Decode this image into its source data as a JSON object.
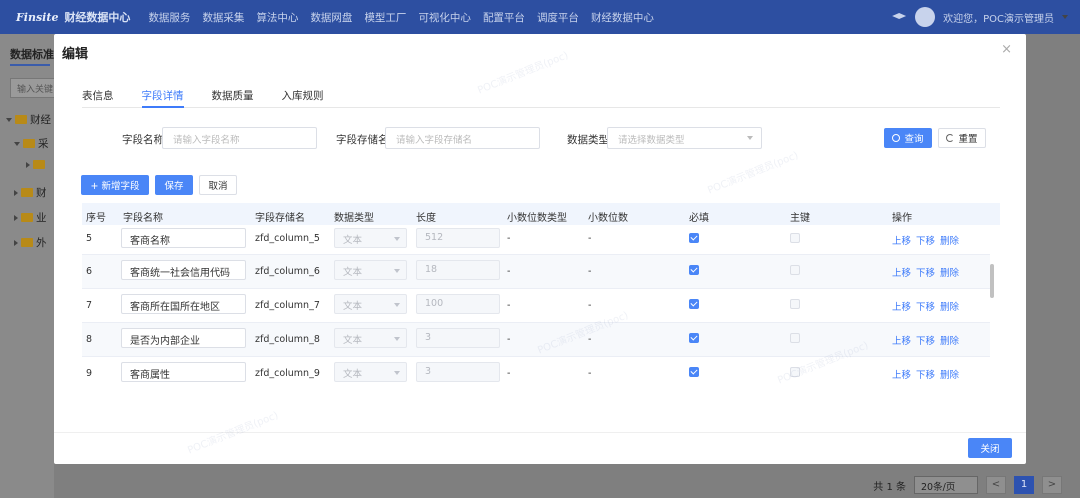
{
  "topbar": {
    "logo": "Finsite",
    "brand": "财经数据中心",
    "nav": [
      "数据服务",
      "数据采集",
      "算法中心",
      "数据网盘",
      "模型工厂",
      "可视化中心",
      "配置平台",
      "调度平台",
      "财经数据中心"
    ],
    "user": "欢迎您，POC演示管理员"
  },
  "sidebar": {
    "title": "数据标准",
    "search_placeholder": "输入关键",
    "tree": [
      "财经",
      "采",
      "",
      "财",
      "业",
      "外"
    ]
  },
  "background_pager": {
    "total": "共 1 条",
    "page_size": "20条/页",
    "prev": "<",
    "page": "1",
    "next": ">"
  },
  "modal": {
    "title": "编辑",
    "close": "×",
    "tabs": [
      "表信息",
      "字段详情",
      "数据质量",
      "入库规则"
    ],
    "active_tab": 1,
    "filters": {
      "field_name_label": "字段名称",
      "field_name_placeholder": "请输入字段名称",
      "storage_name_label": "字段存储名",
      "storage_name_placeholder": "请输入字段存储名",
      "data_type_label": "数据类型",
      "data_type_placeholder": "请选择数据类型",
      "query_label": "查询",
      "reset_label": "重置"
    },
    "toolbar": {
      "add_label": "+ 新增字段",
      "save_label": "保存",
      "cancel_label": "取消"
    },
    "table": {
      "headers": [
        "序号",
        "字段名称",
        "字段存储名",
        "数据类型",
        "长度",
        "小数位数类型",
        "小数位数",
        "必填",
        "主键",
        "操作"
      ],
      "rows": [
        {
          "no": "5",
          "name": "客商名称",
          "storage": "zfd_column_5",
          "type": "文本",
          "length": "512",
          "decimal_type": "-",
          "decimal": "-",
          "required": true,
          "pk": false
        },
        {
          "no": "6",
          "name": "客商统一社会信用代码",
          "storage": "zfd_column_6",
          "type": "文本",
          "length": "18",
          "decimal_type": "-",
          "decimal": "-",
          "required": true,
          "pk": false
        },
        {
          "no": "7",
          "name": "客商所在国所在地区",
          "storage": "zfd_column_7",
          "type": "文本",
          "length": "100",
          "decimal_type": "-",
          "decimal": "-",
          "required": true,
          "pk": false
        },
        {
          "no": "8",
          "name": "是否为内部企业",
          "storage": "zfd_column_8",
          "type": "文本",
          "length": "3",
          "decimal_type": "-",
          "decimal": "-",
          "required": true,
          "pk": false
        },
        {
          "no": "9",
          "name": "客商属性",
          "storage": "zfd_column_9",
          "type": "文本",
          "length": "3",
          "decimal_type": "-",
          "decimal": "-",
          "required": true,
          "pk": false
        }
      ],
      "actions": [
        "上移",
        "下移",
        "删除"
      ]
    },
    "footer_close_label": "关闭"
  },
  "watermark_text": "POC演示管理员(poc)",
  "colors": {
    "primary": "#4a86f7",
    "topbar": "#2d4fa1",
    "link": "#3e7bfa"
  }
}
